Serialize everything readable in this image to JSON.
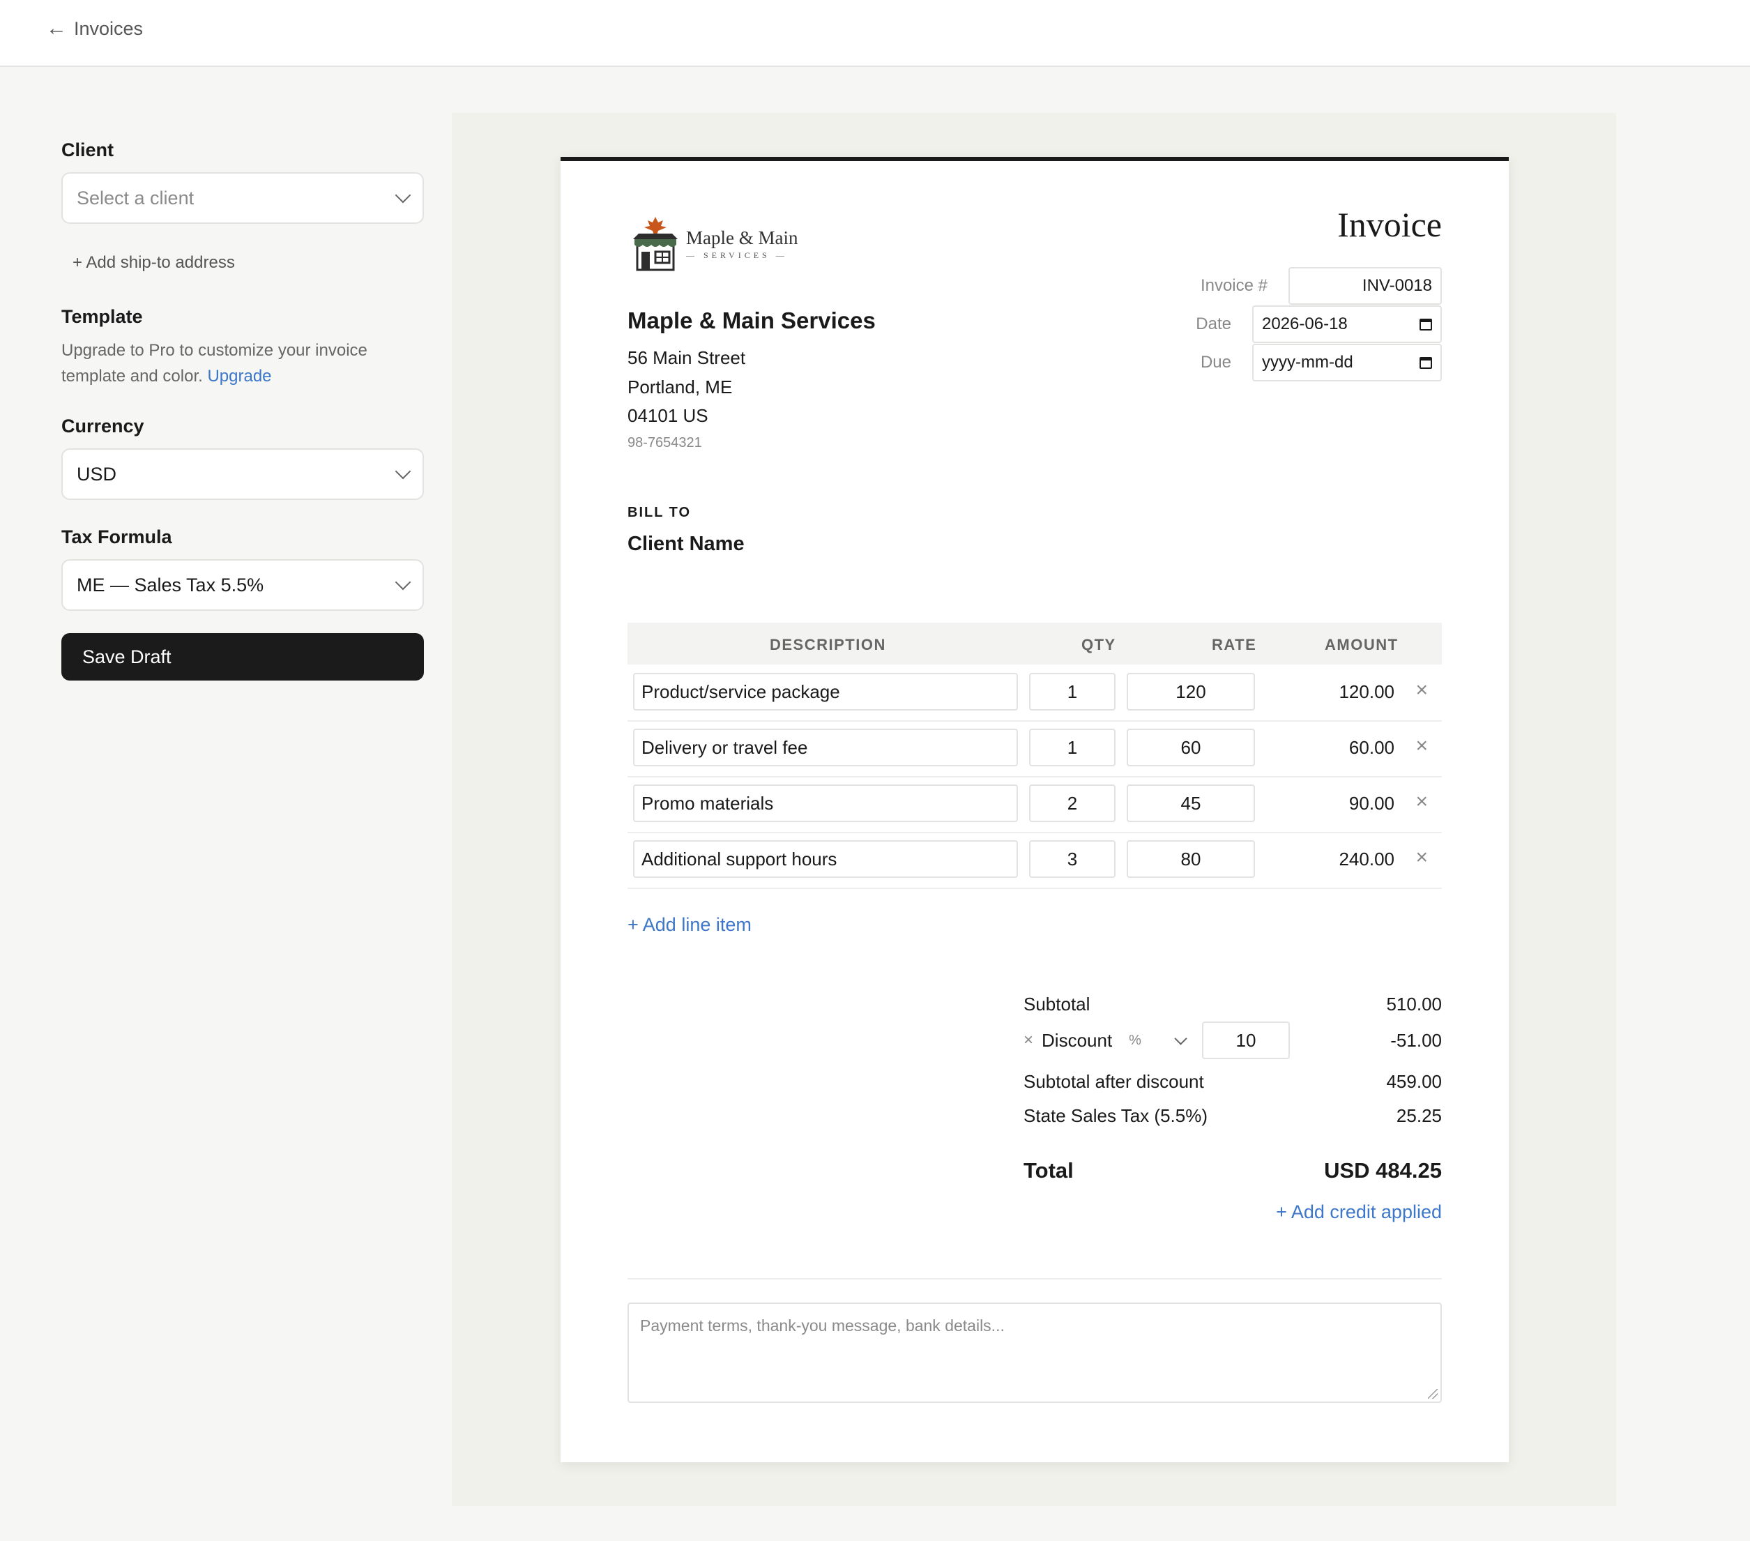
{
  "topbar": {
    "back_label": "Invoices"
  },
  "sidebar": {
    "client_label": "Client",
    "client_placeholder": "Select a client",
    "ship_to_link": "+ Add ship-to address",
    "template_label": "Template",
    "template_desc": "Upgrade to Pro to customize your invoice template and color.",
    "upgrade_link": "Upgrade",
    "currency_label": "Currency",
    "currency_value": "USD",
    "tax_label": "Tax Formula",
    "tax_value": "ME — Sales Tax 5.5%",
    "save_label": "Save Draft"
  },
  "invoice": {
    "title": "Invoice",
    "logo_name": "Maple & Main",
    "logo_sub": "— SERVICES —",
    "invoice_no_label": "Invoice #",
    "invoice_no": "INV-0018",
    "date_label": "Date",
    "date_value": "2026-06-18",
    "due_label": "Due",
    "due_value": "yyyy-mm-dd",
    "business": {
      "name": "Maple & Main Services",
      "street": "56 Main Street",
      "city": "Portland, ME",
      "zip": "04101 US",
      "tax_id": "98-7654321"
    },
    "bill_to_label": "BILL TO",
    "client_name": "Client Name",
    "columns": {
      "description": "DESCRIPTION",
      "qty": "QTY",
      "rate": "RATE",
      "amount": "AMOUNT"
    },
    "items": [
      {
        "description": "Product/service package",
        "qty": "1",
        "rate": "120",
        "amount": "120.00"
      },
      {
        "description": "Delivery or travel fee",
        "qty": "1",
        "rate": "60",
        "amount": "60.00"
      },
      {
        "description": "Promo materials",
        "qty": "2",
        "rate": "45",
        "amount": "90.00"
      },
      {
        "description": "Additional support hours",
        "qty": "3",
        "rate": "80",
        "amount": "240.00"
      }
    ],
    "remove_icon": "×",
    "add_line": "+ Add line item",
    "totals": {
      "subtotal_label": "Subtotal",
      "subtotal": "510.00",
      "discount_label": "Discount",
      "discount_type": "%",
      "discount_value": "10",
      "discount_amount": "-51.00",
      "after_discount_label": "Subtotal after discount",
      "after_discount": "459.00",
      "tax_label": "State Sales Tax (5.5%)",
      "tax": "25.25",
      "total_label": "Total",
      "total": "USD 484.25"
    },
    "add_credit": "+ Add credit applied",
    "notes_placeholder": "Payment terms, thank-you message, bank details..."
  },
  "colors": {
    "accent": "#3d77c9",
    "button": "#1b1b1b",
    "logo_leaf": "#c8571b"
  },
  "icons": {
    "back": "left-arrow-icon",
    "chevron": "chevron-down-icon",
    "calendar": "calendar-icon",
    "remove": "close-icon",
    "logo": "storefront-icon"
  }
}
